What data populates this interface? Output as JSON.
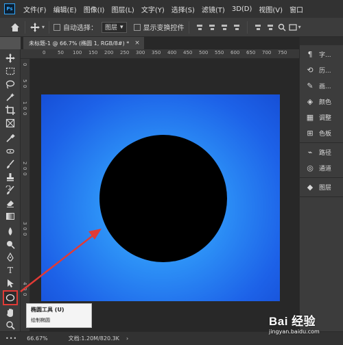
{
  "app": {
    "logo": "Ps"
  },
  "menu": [
    "文件(F)",
    "编辑(E)",
    "图像(I)",
    "图层(L)",
    "文字(Y)",
    "选择(S)",
    "滤镜(T)",
    "3D(D)",
    "视图(V)",
    "窗口"
  ],
  "options": {
    "auto_select_label": "自动选择：",
    "auto_select_value": "图层",
    "show_transform_label": "显示变换控件"
  },
  "document": {
    "tab_title": "未标题-1 @ 66.7% (椭圆 1, RGB/8#) *",
    "close_glyph": "×"
  },
  "ruler": {
    "top_ticks": [
      "0",
      "50",
      "100",
      "150",
      "200",
      "250",
      "300",
      "350",
      "400",
      "450",
      "500",
      "550",
      "600",
      "650",
      "700",
      "750"
    ],
    "left_ticks": [
      "0",
      "5",
      "0",
      "1",
      "0",
      "0",
      "2",
      "0",
      "0",
      "3",
      "0",
      "0",
      "4",
      "0",
      "0"
    ]
  },
  "panels": {
    "group1": [
      {
        "icon": "paragraph-icon",
        "glyph": "¶",
        "label": "字..."
      },
      {
        "icon": "history-icon",
        "glyph": "⟲",
        "label": "历..."
      },
      {
        "icon": "brush-icon",
        "glyph": "✎",
        "label": "画..."
      },
      {
        "icon": "color-icon",
        "glyph": "◈",
        "label": "颜色"
      },
      {
        "icon": "swatches-icon",
        "glyph": "▦",
        "label": "调整"
      },
      {
        "icon": "color-board-icon",
        "glyph": "⊞",
        "label": "色板"
      }
    ],
    "group2": [
      {
        "icon": "paths-icon",
        "glyph": "⌁",
        "label": "路径"
      },
      {
        "icon": "channels-icon",
        "glyph": "◎",
        "label": "通道"
      }
    ],
    "group3": [
      {
        "icon": "layers-icon",
        "glyph": "◆",
        "label": "图层"
      }
    ]
  },
  "status": {
    "zoom": "66.67%",
    "doc_info": "文档:1.20M/820.3K",
    "arrow": "›"
  },
  "tooltip": {
    "title": "椭圆工具 (U)",
    "description": "绘制椭圆"
  },
  "watermark": {
    "brand": "Bai 经验",
    "url": "jingyan.baidu.com"
  },
  "colors": {
    "accent_red": "#e13b36",
    "canvas_blue": "#2b8cf5",
    "shape_fill": "#000000"
  }
}
